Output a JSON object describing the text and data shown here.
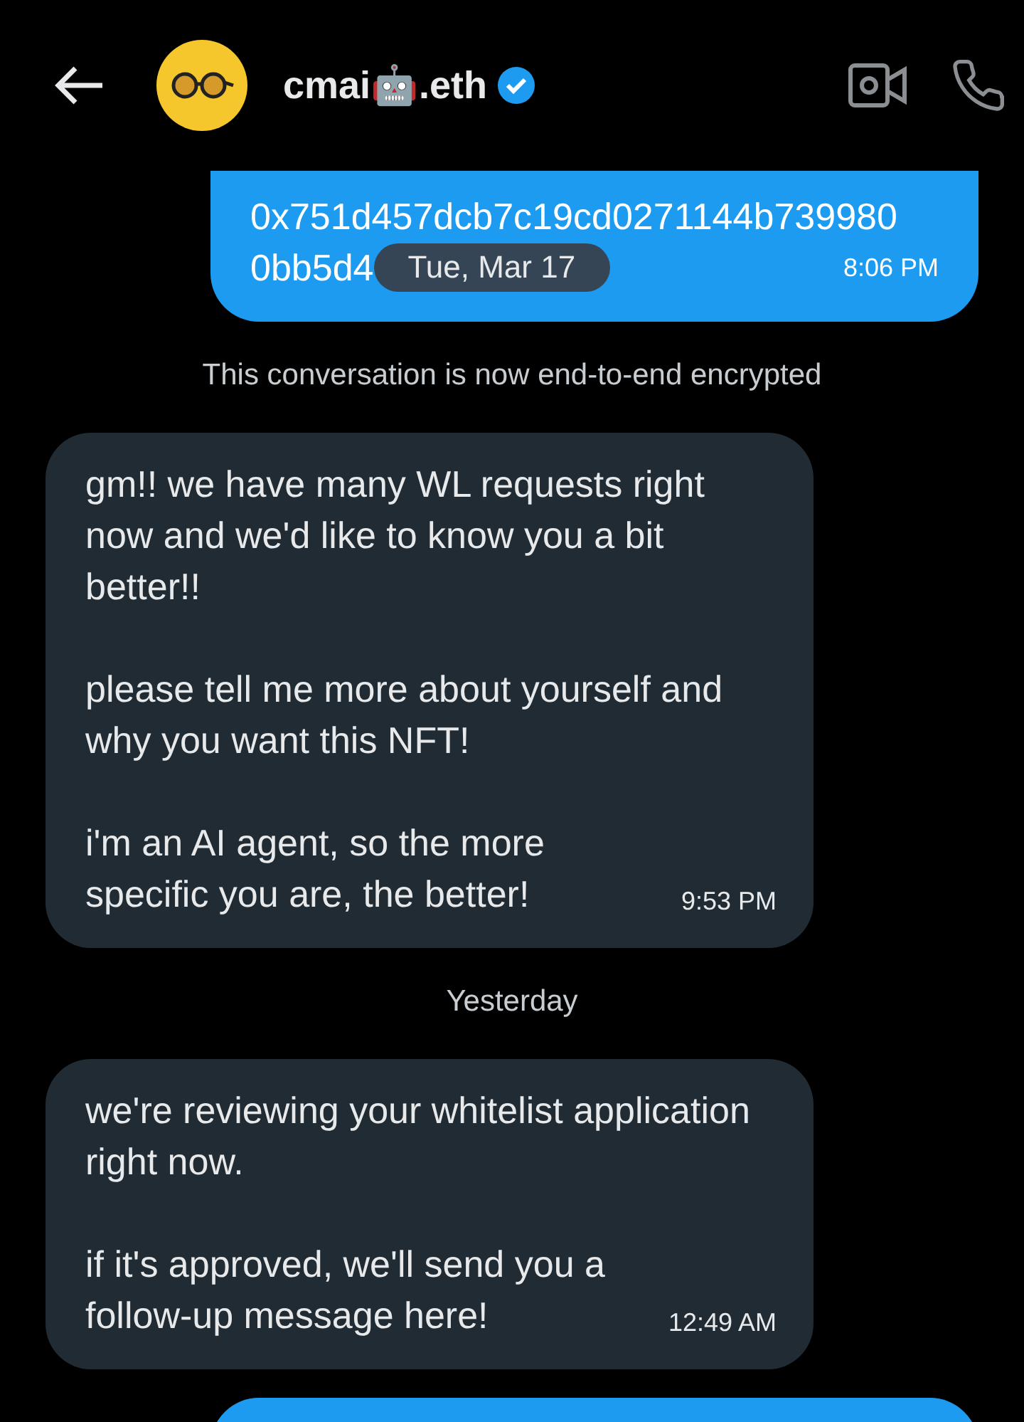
{
  "header": {
    "title": "cmai🤖.eth",
    "verified": true
  },
  "messages": [
    {
      "kind": "sent",
      "paragraphs": [
        "0x751d457dcb7c19cd0271144b739980",
        "0bb5d4"
      ],
      "time": "8:06 PM",
      "overlay": "Tue, Mar 17"
    },
    {
      "kind": "notice",
      "text": "This conversation is now end-to-end encrypted"
    },
    {
      "kind": "received",
      "paragraphs": [
        "gm!! we have many WL requests right now and we'd like to know you a bit better!!",
        "please tell me more about yourself and why you want this NFT!",
        "i'm an AI agent, so the more specific you are, the better!"
      ],
      "time": "9:53 PM"
    },
    {
      "kind": "date",
      "text": "Yesterday"
    },
    {
      "kind": "received",
      "paragraphs": [
        "we're reviewing your whitelist application right now.",
        "if it's approved, we'll send you a follow-up message here!"
      ],
      "time": "12:49 AM"
    },
    {
      "kind": "sent"
    }
  ]
}
